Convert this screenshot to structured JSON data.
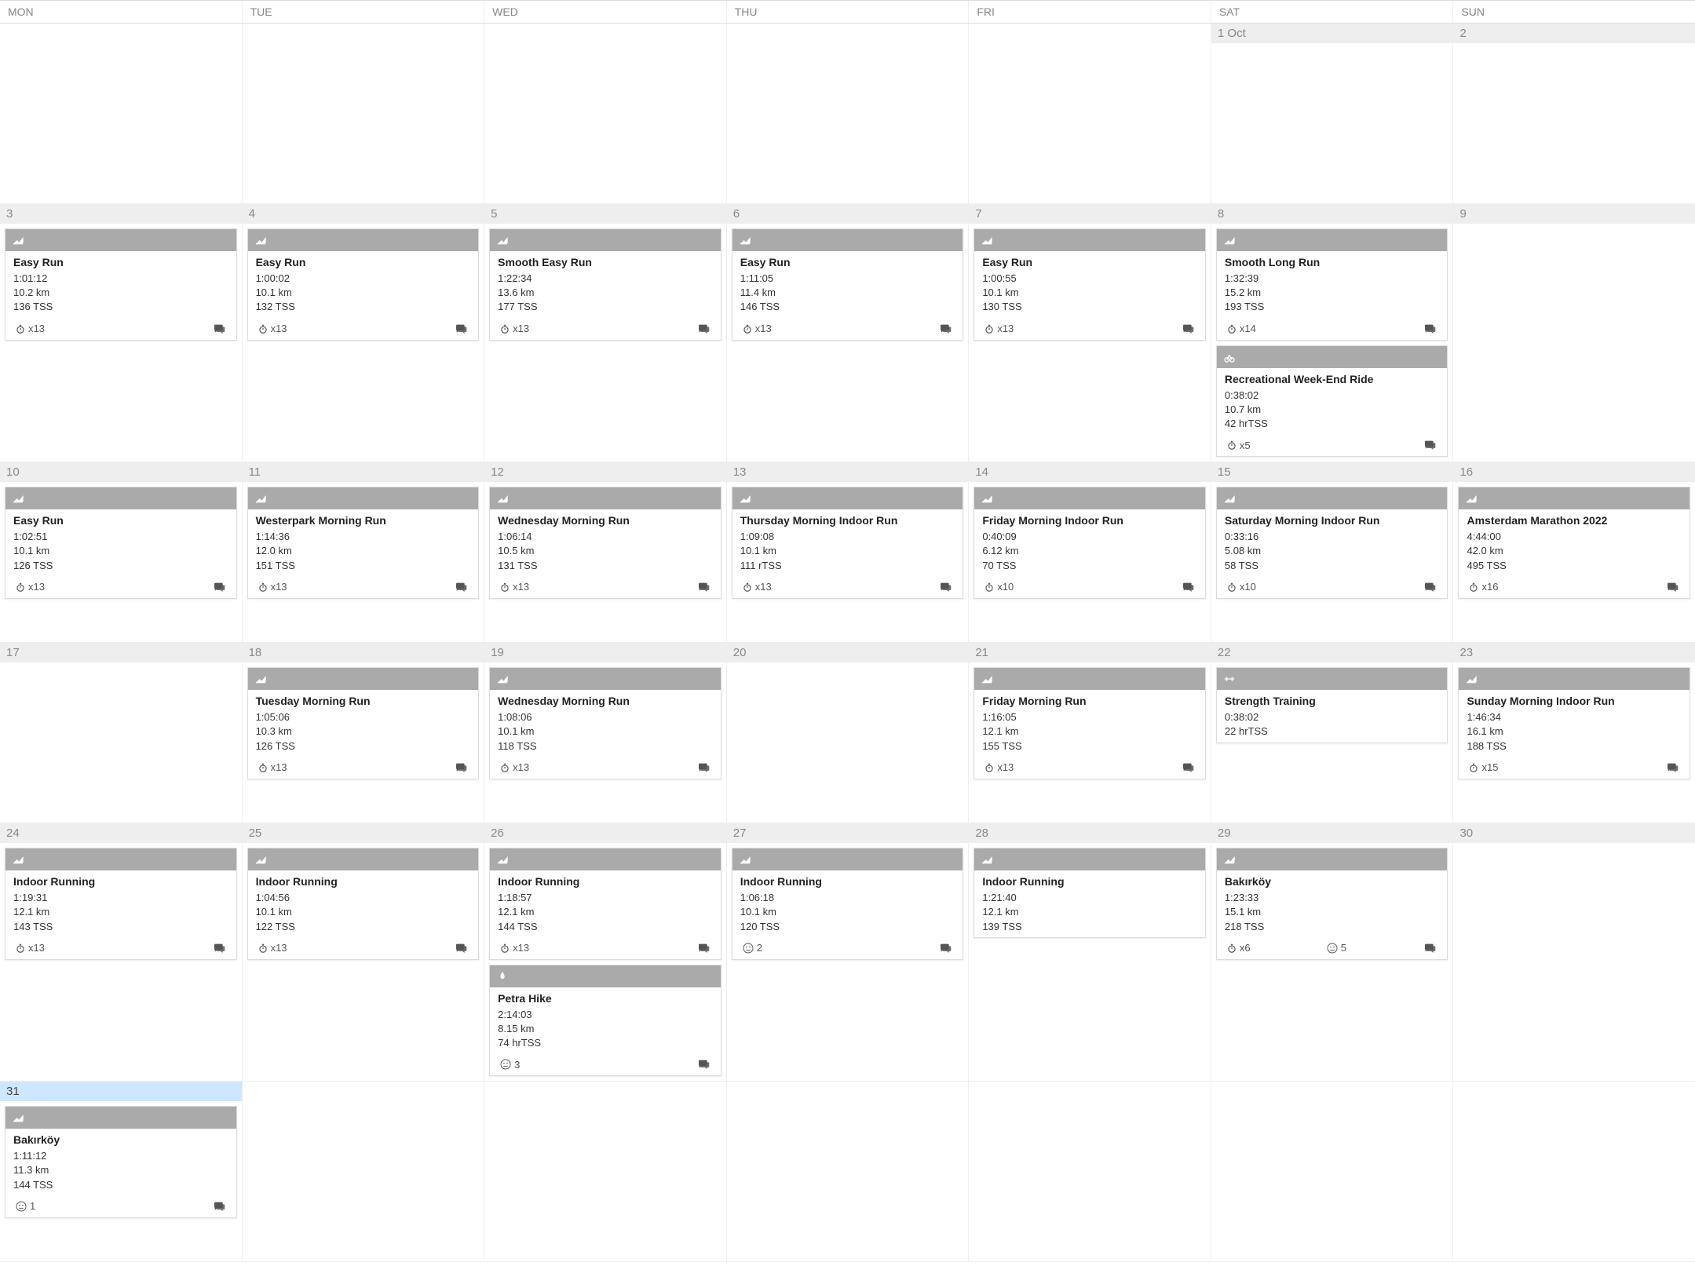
{
  "dayHeaders": [
    "MON",
    "TUE",
    "WED",
    "THU",
    "FRI",
    "SAT",
    "SUN"
  ],
  "weeks": [
    {
      "days": [
        {
          "label": "",
          "empty": true
        },
        {
          "label": "",
          "empty": true
        },
        {
          "label": "",
          "empty": true
        },
        {
          "label": "",
          "empty": true
        },
        {
          "label": "",
          "empty": true
        },
        {
          "label": "1 Oct",
          "workouts": []
        },
        {
          "label": "2",
          "workouts": []
        }
      ]
    },
    {
      "days": [
        {
          "label": "3",
          "workouts": [
            {
              "sport": "run",
              "title": "Easy Run",
              "duration": "1:01:12",
              "distance": "10.2 km",
              "tss": "136 TSS",
              "charts": "x13",
              "hasChat": true
            }
          ]
        },
        {
          "label": "4",
          "workouts": [
            {
              "sport": "run",
              "title": "Easy Run",
              "duration": "1:00:02",
              "distance": "10.1 km",
              "tss": "132 TSS",
              "charts": "x13",
              "hasChat": true
            }
          ]
        },
        {
          "label": "5",
          "workouts": [
            {
              "sport": "run",
              "title": "Smooth Easy Run",
              "duration": "1:22:34",
              "distance": "13.6 km",
              "tss": "177 TSS",
              "charts": "x13",
              "hasChat": true
            }
          ]
        },
        {
          "label": "6",
          "workouts": [
            {
              "sport": "run",
              "title": "Easy Run",
              "duration": "1:11:05",
              "distance": "11.4 km",
              "tss": "146 TSS",
              "charts": "x13",
              "hasChat": true
            }
          ]
        },
        {
          "label": "7",
          "workouts": [
            {
              "sport": "run",
              "title": "Easy Run",
              "duration": "1:00:55",
              "distance": "10.1 km",
              "tss": "130 TSS",
              "charts": "x13",
              "hasChat": true
            }
          ]
        },
        {
          "label": "8",
          "workouts": [
            {
              "sport": "run",
              "title": "Smooth Long Run",
              "duration": "1:32:39",
              "distance": "15.2 km",
              "tss": "193 TSS",
              "charts": "x14",
              "hasChat": true
            },
            {
              "sport": "bike",
              "title": "Recreational Week-End Ride",
              "duration": "0:38:02",
              "distance": "10.7 km",
              "tss": "42 hrTSS",
              "charts": "x5",
              "hasChat": true
            }
          ]
        },
        {
          "label": "9",
          "workouts": []
        }
      ]
    },
    {
      "days": [
        {
          "label": "10",
          "workouts": [
            {
              "sport": "run",
              "title": "Easy Run",
              "duration": "1:02:51",
              "distance": "10.1 km",
              "tss": "126 TSS",
              "charts": "x13",
              "hasChat": true
            }
          ]
        },
        {
          "label": "11",
          "workouts": [
            {
              "sport": "run",
              "title": "Westerpark Morning Run",
              "duration": "1:14:36",
              "distance": "12.0 km",
              "tss": "151 TSS",
              "charts": "x13",
              "hasChat": true
            }
          ]
        },
        {
          "label": "12",
          "workouts": [
            {
              "sport": "run",
              "title": "Wednesday Morning Run",
              "duration": "1:06:14",
              "distance": "10.5 km",
              "tss": "131 TSS",
              "charts": "x13",
              "hasChat": true
            }
          ]
        },
        {
          "label": "13",
          "workouts": [
            {
              "sport": "run",
              "title": "Thursday Morning Indoor Run",
              "duration": "1:09:08",
              "distance": "10.1 km",
              "tss": "111 rTSS",
              "charts": "x13",
              "hasChat": true
            }
          ]
        },
        {
          "label": "14",
          "workouts": [
            {
              "sport": "run",
              "title": "Friday Morning Indoor Run",
              "duration": "0:40:09",
              "distance": "6.12 km",
              "tss": "70 TSS",
              "charts": "x10",
              "hasChat": true
            }
          ]
        },
        {
          "label": "15",
          "workouts": [
            {
              "sport": "run",
              "title": "Saturday Morning Indoor Run",
              "duration": "0:33:16",
              "distance": "5.08 km",
              "tss": "58 TSS",
              "charts": "x10",
              "hasChat": true
            }
          ]
        },
        {
          "label": "16",
          "workouts": [
            {
              "sport": "run",
              "title": "Amsterdam Marathon 2022",
              "duration": "4:44:00",
              "distance": "42.0 km",
              "tss": "495 TSS",
              "charts": "x16",
              "hasChat": true
            }
          ]
        }
      ]
    },
    {
      "days": [
        {
          "label": "17",
          "workouts": []
        },
        {
          "label": "18",
          "workouts": [
            {
              "sport": "run",
              "title": "Tuesday Morning Run",
              "duration": "1:05:06",
              "distance": "10.3 km",
              "tss": "126 TSS",
              "charts": "x13",
              "hasChat": true
            }
          ]
        },
        {
          "label": "19",
          "workouts": [
            {
              "sport": "run",
              "title": "Wednesday Morning Run",
              "duration": "1:08:06",
              "distance": "10.1 km",
              "tss": "118 TSS",
              "charts": "x13",
              "hasChat": true
            }
          ]
        },
        {
          "label": "20",
          "workouts": []
        },
        {
          "label": "21",
          "workouts": [
            {
              "sport": "run",
              "title": "Friday Morning Run",
              "duration": "1:16:05",
              "distance": "12.1 km",
              "tss": "155 TSS",
              "charts": "x13",
              "hasChat": true
            }
          ]
        },
        {
          "label": "22",
          "workouts": [
            {
              "sport": "strength",
              "title": "Strength Training",
              "duration": "0:38:02",
              "distance": "",
              "tss": "22 hrTSS",
              "charts": "",
              "hasChat": false
            }
          ]
        },
        {
          "label": "23",
          "workouts": [
            {
              "sport": "run",
              "title": "Sunday Morning Indoor Run",
              "duration": "1:46:34",
              "distance": "16.1 km",
              "tss": "188 TSS",
              "charts": "x15",
              "hasChat": true
            }
          ]
        }
      ]
    },
    {
      "days": [
        {
          "label": "24",
          "workouts": [
            {
              "sport": "run",
              "title": "Indoor Running",
              "duration": "1:19:31",
              "distance": "12.1 km",
              "tss": "143 TSS",
              "charts": "x13",
              "hasChat": true
            }
          ]
        },
        {
          "label": "25",
          "workouts": [
            {
              "sport": "run",
              "title": "Indoor Running",
              "duration": "1:04:56",
              "distance": "10.1 km",
              "tss": "122 TSS",
              "charts": "x13",
              "hasChat": true
            }
          ]
        },
        {
          "label": "26",
          "workouts": [
            {
              "sport": "run",
              "title": "Indoor Running",
              "duration": "1:18:57",
              "distance": "12.1 km",
              "tss": "144 TSS",
              "charts": "x13",
              "hasChat": true
            },
            {
              "sport": "hike",
              "title": "Petra Hike",
              "duration": "2:14:03",
              "distance": "8.15 km",
              "tss": "74 hrTSS",
              "smile": "3",
              "hasChat": true
            }
          ]
        },
        {
          "label": "27",
          "workouts": [
            {
              "sport": "run",
              "title": "Indoor Running",
              "duration": "1:06:18",
              "distance": "10.1 km",
              "tss": "120 TSS",
              "smile": "2",
              "hasChat": true
            }
          ]
        },
        {
          "label": "28",
          "workouts": [
            {
              "sport": "run",
              "title": "Indoor Running",
              "duration": "1:21:40",
              "distance": "12.1 km",
              "tss": "139 TSS",
              "charts": "",
              "hasChat": false
            }
          ]
        },
        {
          "label": "29",
          "workouts": [
            {
              "sport": "run",
              "title": "Bakırköy",
              "duration": "1:23:33",
              "distance": "15.1 km",
              "tss": "218 TSS",
              "charts": "x6",
              "smile": "5",
              "hasChat": true
            }
          ]
        },
        {
          "label": "30",
          "workouts": []
        }
      ]
    },
    {
      "days": [
        {
          "label": "31",
          "today": true,
          "workouts": [
            {
              "sport": "run",
              "title": "Bakırköy",
              "duration": "1:11:12",
              "distance": "11.3 km",
              "tss": "144 TSS",
              "smile": "1",
              "hasChat": true
            }
          ]
        },
        {
          "label": "",
          "empty": true
        },
        {
          "label": "",
          "empty": true
        },
        {
          "label": "",
          "empty": true
        },
        {
          "label": "",
          "empty": true
        },
        {
          "label": "",
          "empty": true
        },
        {
          "label": "",
          "empty": true
        }
      ]
    }
  ]
}
